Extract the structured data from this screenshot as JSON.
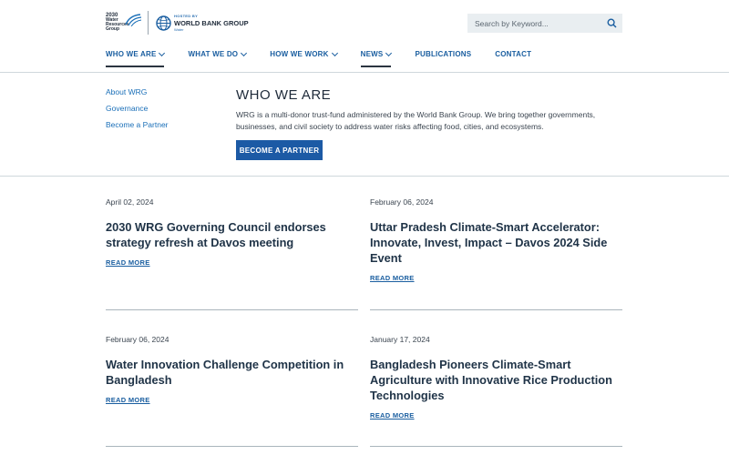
{
  "header": {
    "wrg_logo": {
      "year": "2030",
      "line1": "Water",
      "line2": "Resources",
      "line3": "Group"
    },
    "wbg_logo": {
      "hosted": "HOSTED BY",
      "name": "WORLD BANK GROUP",
      "sub": "Water"
    },
    "search": {
      "placeholder": "Search by Keyword..."
    },
    "nav": [
      {
        "label": "WHO WE ARE",
        "has_dropdown": true,
        "active": true
      },
      {
        "label": "WHAT WE DO",
        "has_dropdown": true
      },
      {
        "label": "HOW WE WORK",
        "has_dropdown": true
      },
      {
        "label": "NEWS",
        "has_dropdown": true,
        "active_underline": true
      },
      {
        "label": "PUBLICATIONS",
        "has_dropdown": false
      },
      {
        "label": "CONTACT",
        "has_dropdown": false
      }
    ]
  },
  "sidebar": {
    "links": [
      "About WRG",
      "Governance",
      "Become a Partner"
    ]
  },
  "intro": {
    "title": "WHO WE ARE",
    "text": "WRG is a multi-donor trust-fund administered by the World Bank Group. We bring together governments, businesses, and civil society to address water risks affecting food, cities, and ecosystems.",
    "button": "BECOME A PARTNER"
  },
  "news": [
    {
      "date": "April 02, 2024",
      "title": "2030 WRG Governing Council endorses strategy refresh at Davos meeting",
      "more": "READ MORE"
    },
    {
      "date": "February 06, 2024",
      "title": "Uttar Pradesh Climate-Smart Accelerator: Innovate, Invest, Impact – Davos 2024 Side Event",
      "more": "READ MORE"
    },
    {
      "date": "February 06, 2024",
      "title": "Water Innovation Challenge Competition in Bangladesh",
      "more": "READ MORE"
    },
    {
      "date": "January 17, 2024",
      "title": "Bangladesh Pioneers Climate-Smart Agriculture with Innovative Rice Production Technologies",
      "more": "READ MORE"
    }
  ],
  "colors": {
    "accent": "#1c5aa5",
    "link": "#1a6fb8",
    "text": "#1f3347"
  }
}
